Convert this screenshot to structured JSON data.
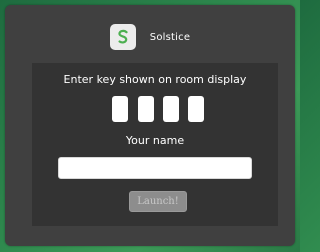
{
  "brand": {
    "name": "Solstice",
    "logo_icon": "solstice-s-logo-icon",
    "logo_color": "#4caf50"
  },
  "form": {
    "key_prompt": "Enter key shown on room display",
    "key_digits": [
      "",
      "",
      "",
      ""
    ],
    "name_label": "Your name",
    "name_value": "",
    "launch_label": "Launch!"
  },
  "colors": {
    "background_green": "#2f8a4e",
    "panel": "#404040",
    "inner_panel": "#333333",
    "button_disabled": "#8d8d8d"
  }
}
